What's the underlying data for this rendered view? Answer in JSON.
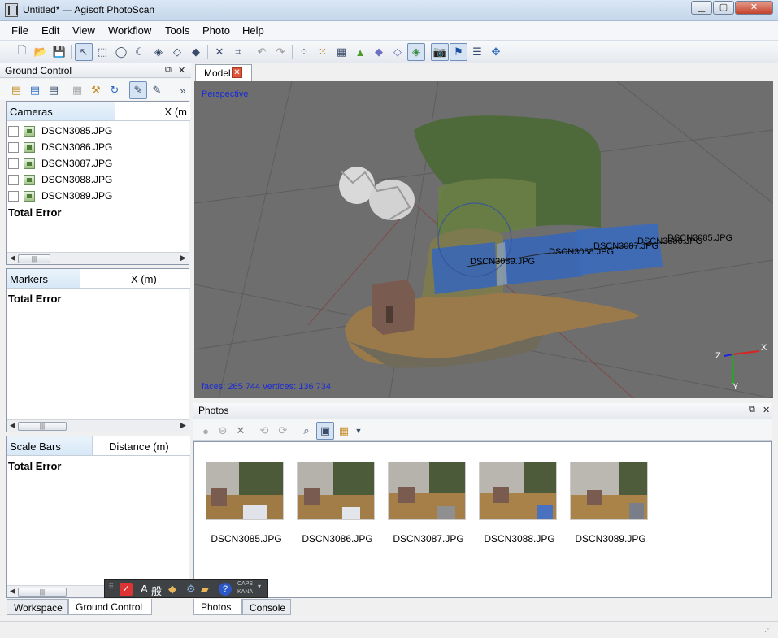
{
  "window": {
    "title": "Untitled* — Agisoft PhotoScan"
  },
  "menu": [
    "File",
    "Edit",
    "View",
    "Workflow",
    "Tools",
    "Photo",
    "Help"
  ],
  "ground_control": {
    "title": "Ground Control",
    "cameras": {
      "col1": "Cameras",
      "col2": "X (m",
      "items": [
        "DSCN3085.JPG",
        "DSCN3086.JPG",
        "DSCN3087.JPG",
        "DSCN3088.JPG",
        "DSCN3089.JPG"
      ],
      "total": "Total Error"
    },
    "markers": {
      "col1": "Markers",
      "col2": "X (m)",
      "total": "Total Error"
    },
    "scale_bars": {
      "col1": "Scale Bars",
      "col2": "Distance (m)",
      "total": "Total Error"
    }
  },
  "model": {
    "tab": "Model",
    "projection": "Perspective",
    "stats": "faces: 265 744 vertices: 136 734",
    "camera_labels": [
      "DSCN3085.JPG",
      "DSCN3086.JPG",
      "DSCN3087.JPG",
      "DSCN3088.JPG",
      "DSCN3089.JPG"
    ],
    "axes": {
      "x": "X",
      "y": "Y",
      "z": "Z"
    }
  },
  "photos": {
    "title": "Photos",
    "items": [
      "DSCN3085.JPG",
      "DSCN3086.JPG",
      "DSCN3087.JPG",
      "DSCN3088.JPG",
      "DSCN3089.JPG"
    ]
  },
  "bottom_tabs_left": [
    "Workspace",
    "Ground Control"
  ],
  "bottom_tabs_right": [
    "Photos",
    "Console"
  ],
  "ime": {
    "mode": "般",
    "caps": "CAPS",
    "kana": "KANA"
  }
}
